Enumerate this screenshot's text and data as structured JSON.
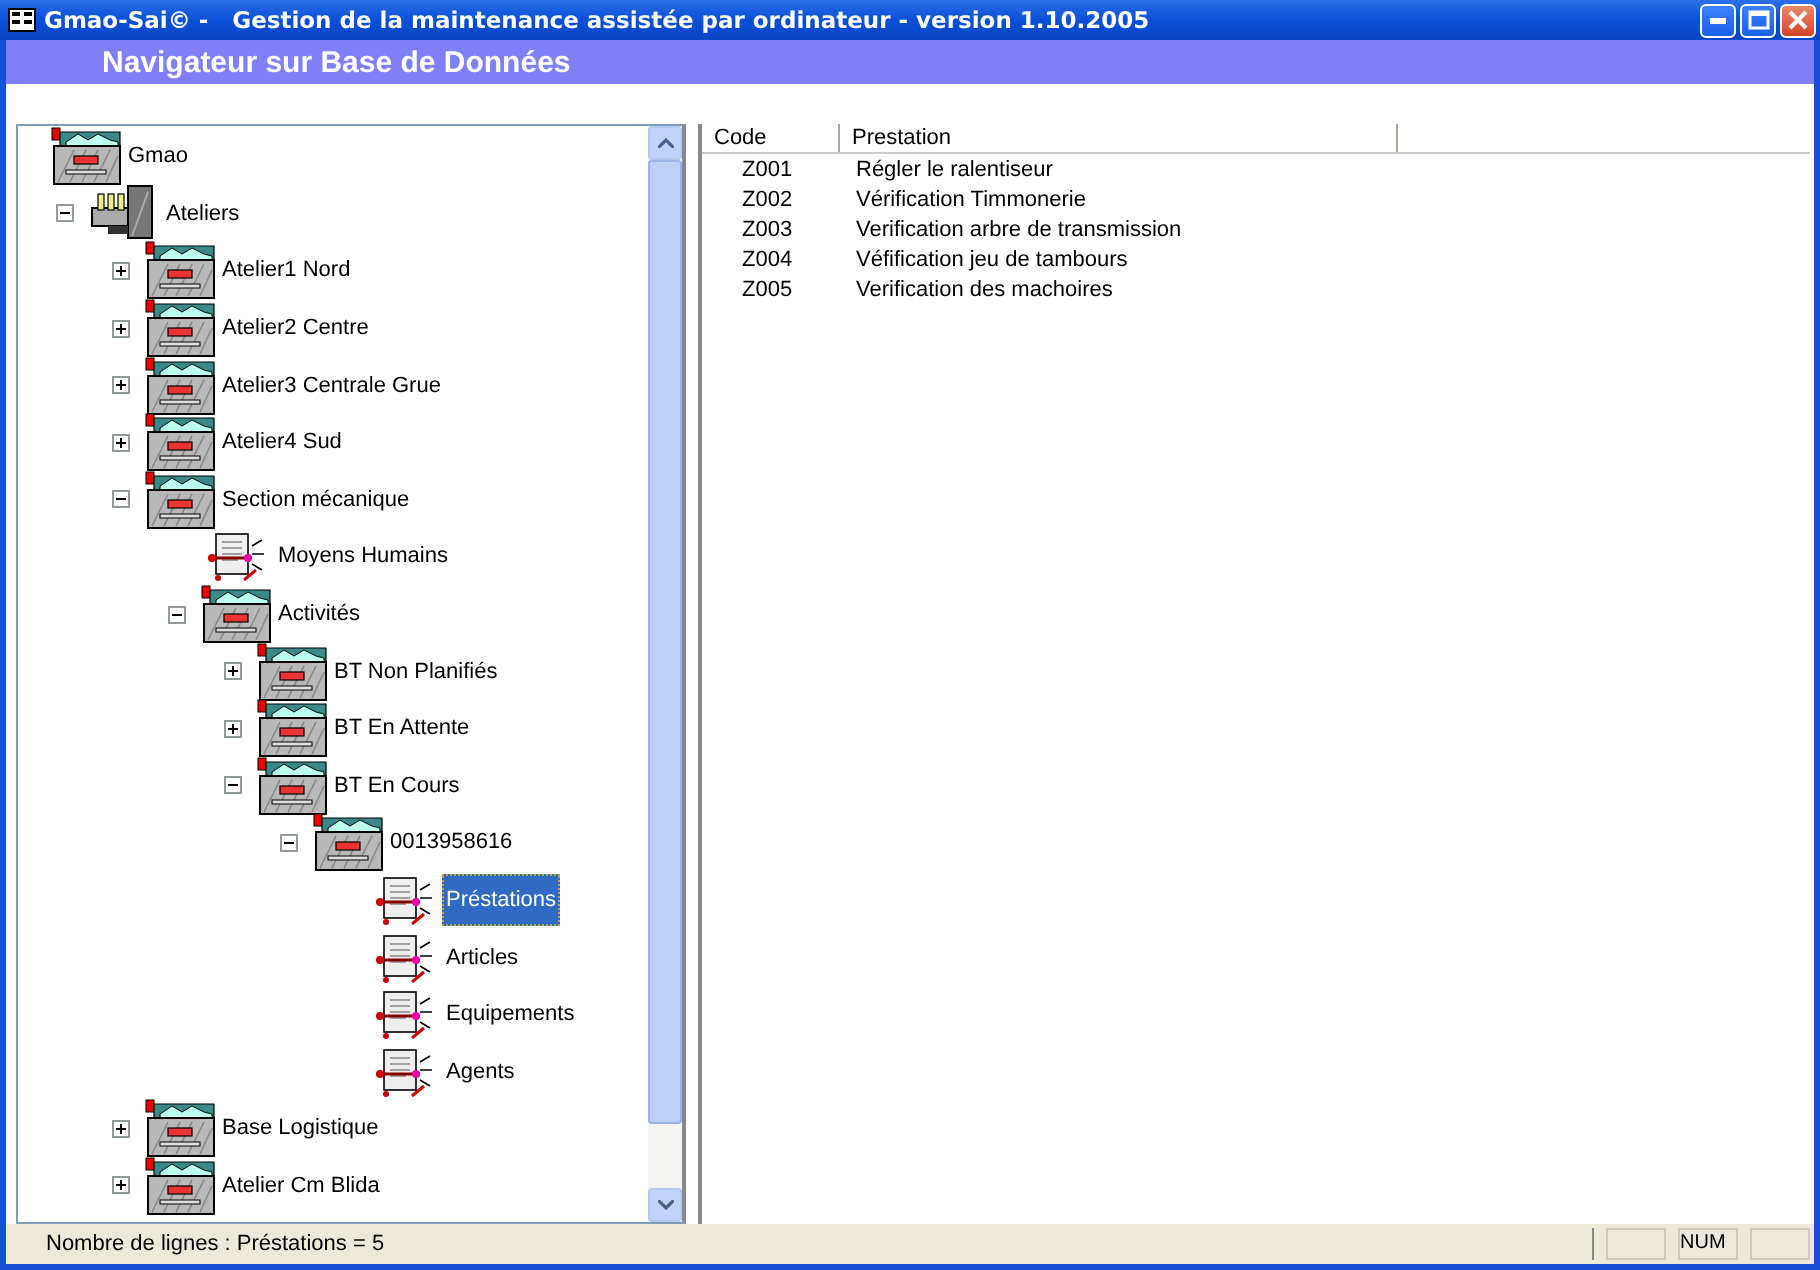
{
  "window": {
    "title": "Gmao-Sai© -   Gestion de la maintenance assistée par ordinateur - version 1.10.2005"
  },
  "header": {
    "title": "Navigateur sur Base de Données"
  },
  "tree": [
    {
      "label": "Gmao",
      "kind": "cabinet",
      "selected": false,
      "children": [
        {
          "label": "Ateliers",
          "kind": "workshop",
          "selected": false,
          "expanded": true,
          "children": [
            {
              "label": "Atelier1 Nord",
              "kind": "cabinet",
              "selected": false,
              "expanded": false
            },
            {
              "label": "Atelier2 Centre",
              "kind": "cabinet",
              "selected": false,
              "expanded": false
            },
            {
              "label": "Atelier3 Centrale Grue",
              "kind": "cabinet",
              "selected": false,
              "expanded": false
            },
            {
              "label": "Atelier4 Sud",
              "kind": "cabinet",
              "selected": false,
              "expanded": false
            },
            {
              "label": "Section mécanique",
              "kind": "cabinet",
              "selected": false,
              "expanded": true,
              "children": [
                {
                  "label": "Moyens Humains",
                  "kind": "form",
                  "selected": false
                },
                {
                  "label": "Activités",
                  "kind": "cabinet",
                  "selected": false,
                  "expanded": true,
                  "children": [
                    {
                      "label": "BT Non Planifiés",
                      "kind": "cabinet",
                      "selected": false,
                      "expanded": false
                    },
                    {
                      "label": "BT En Attente",
                      "kind": "cabinet",
                      "selected": false,
                      "expanded": false
                    },
                    {
                      "label": "BT En Cours",
                      "kind": "cabinet",
                      "selected": false,
                      "expanded": true,
                      "children": [
                        {
                          "label": "0013958616",
                          "kind": "cabinet",
                          "selected": false,
                          "expanded": true,
                          "children": [
                            {
                              "label": "Préstations",
                              "kind": "form",
                              "selected": true
                            },
                            {
                              "label": "Articles",
                              "kind": "form",
                              "selected": false
                            },
                            {
                              "label": "Equipements",
                              "kind": "form",
                              "selected": false
                            },
                            {
                              "label": "Agents",
                              "kind": "form",
                              "selected": false
                            }
                          ]
                        }
                      ]
                    }
                  ]
                }
              ]
            },
            {
              "label": "Base Logistique",
              "kind": "cabinet",
              "selected": false,
              "expanded": false
            },
            {
              "label": "Atelier Cm Blida",
              "kind": "cabinet",
              "selected": false,
              "expanded": false
            }
          ]
        }
      ]
    }
  ],
  "table": {
    "columns": [
      "Code",
      "Prestation"
    ],
    "rows": [
      [
        "Z001",
        "Régler le ralentiseur"
      ],
      [
        "Z002",
        "Vérification Timmonerie"
      ],
      [
        "Z003",
        "Verification arbre de transmission"
      ],
      [
        "Z004",
        "Véfification jeu de tambours"
      ],
      [
        "Z005",
        "Verification des machoires"
      ]
    ]
  },
  "status_bar": {
    "text": "Nombre de lignes  : Préstations =  5",
    "num_indicator": "NUM"
  }
}
